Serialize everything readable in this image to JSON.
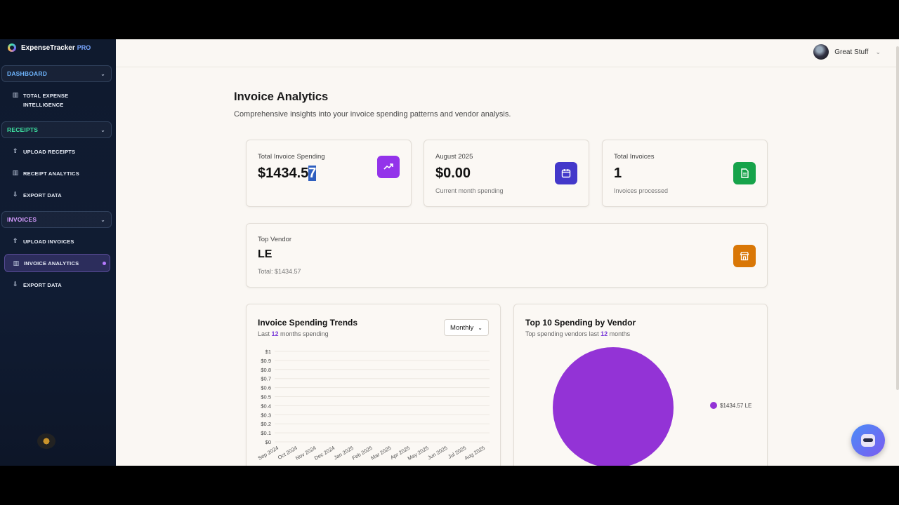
{
  "app": {
    "name": "ExpenseTracker",
    "badge": "PRO"
  },
  "sidebar": {
    "dashboard": {
      "label": "DASHBOARD",
      "items": [
        {
          "label": "TOTAL EXPENSE INTELLIGENCE"
        }
      ]
    },
    "receipts": {
      "label": "RECEIPTS",
      "items": [
        {
          "label": "UPLOAD RECEIPTS"
        },
        {
          "label": "RECEIPT ANALYTICS"
        },
        {
          "label": "EXPORT DATA"
        }
      ]
    },
    "invoices": {
      "label": "INVOICES",
      "items": [
        {
          "label": "UPLOAD INVOICES"
        },
        {
          "label": "INVOICE ANALYTICS",
          "active": true
        },
        {
          "label": "EXPORT DATA"
        }
      ]
    }
  },
  "user": {
    "name": "Great Stuff"
  },
  "page": {
    "title": "Invoice Analytics",
    "subtitle": "Comprehensive insights into your invoice spending patterns and vendor analysis."
  },
  "stats": {
    "total_spending": {
      "label": "Total Invoice Spending",
      "value_main": "$1434.5",
      "value_selected": "7",
      "icon": "trend-up-icon",
      "color": "#9333ea"
    },
    "month": {
      "label": "August 2025",
      "value": "$0.00",
      "sub": "Current month spending",
      "icon": "calendar-icon",
      "color": "#4338ca"
    },
    "total_invoices": {
      "label": "Total Invoices",
      "value": "1",
      "sub": "Invoices processed",
      "icon": "document-icon",
      "color": "#16a34a"
    }
  },
  "top_vendor": {
    "label": "Top Vendor",
    "value": "LE",
    "sub": "Total: $1434.57",
    "icon": "store-icon",
    "color": "#d97706"
  },
  "trends": {
    "title": "Invoice Spending Trends",
    "sub_pre": "Last ",
    "sub_num": "12",
    "sub_post": " months spending",
    "period": "Monthly"
  },
  "vendors": {
    "title": "Top 10 Spending by Vendor",
    "sub_pre": "Top spending vendors last ",
    "sub_num": "12",
    "sub_post": " months",
    "legend": "$1434.57 LE"
  },
  "chart_data": [
    {
      "type": "line",
      "title": "Invoice Spending Trends",
      "x": [
        "Sep 2024",
        "Oct 2024",
        "Nov 2024",
        "Dec 2024",
        "Jan 2025",
        "Feb 2025",
        "Mar 2025",
        "Apr 2025",
        "May 2025",
        "Jun 2025",
        "Jul 2025",
        "Aug 2025"
      ],
      "y_ticks": [
        "$0",
        "$0.1",
        "$0.2",
        "$0.3",
        "$0.4",
        "$0.5",
        "$0.6",
        "$0.7",
        "$0.8",
        "$0.9",
        "$1"
      ],
      "ylim": [
        0,
        1
      ],
      "grid": true
    },
    {
      "type": "pie",
      "title": "Top 10 Spending by Vendor",
      "categories": [
        "LE"
      ],
      "values": [
        1434.57
      ],
      "colors": [
        "#9333d6"
      ],
      "legend": "right"
    }
  ]
}
